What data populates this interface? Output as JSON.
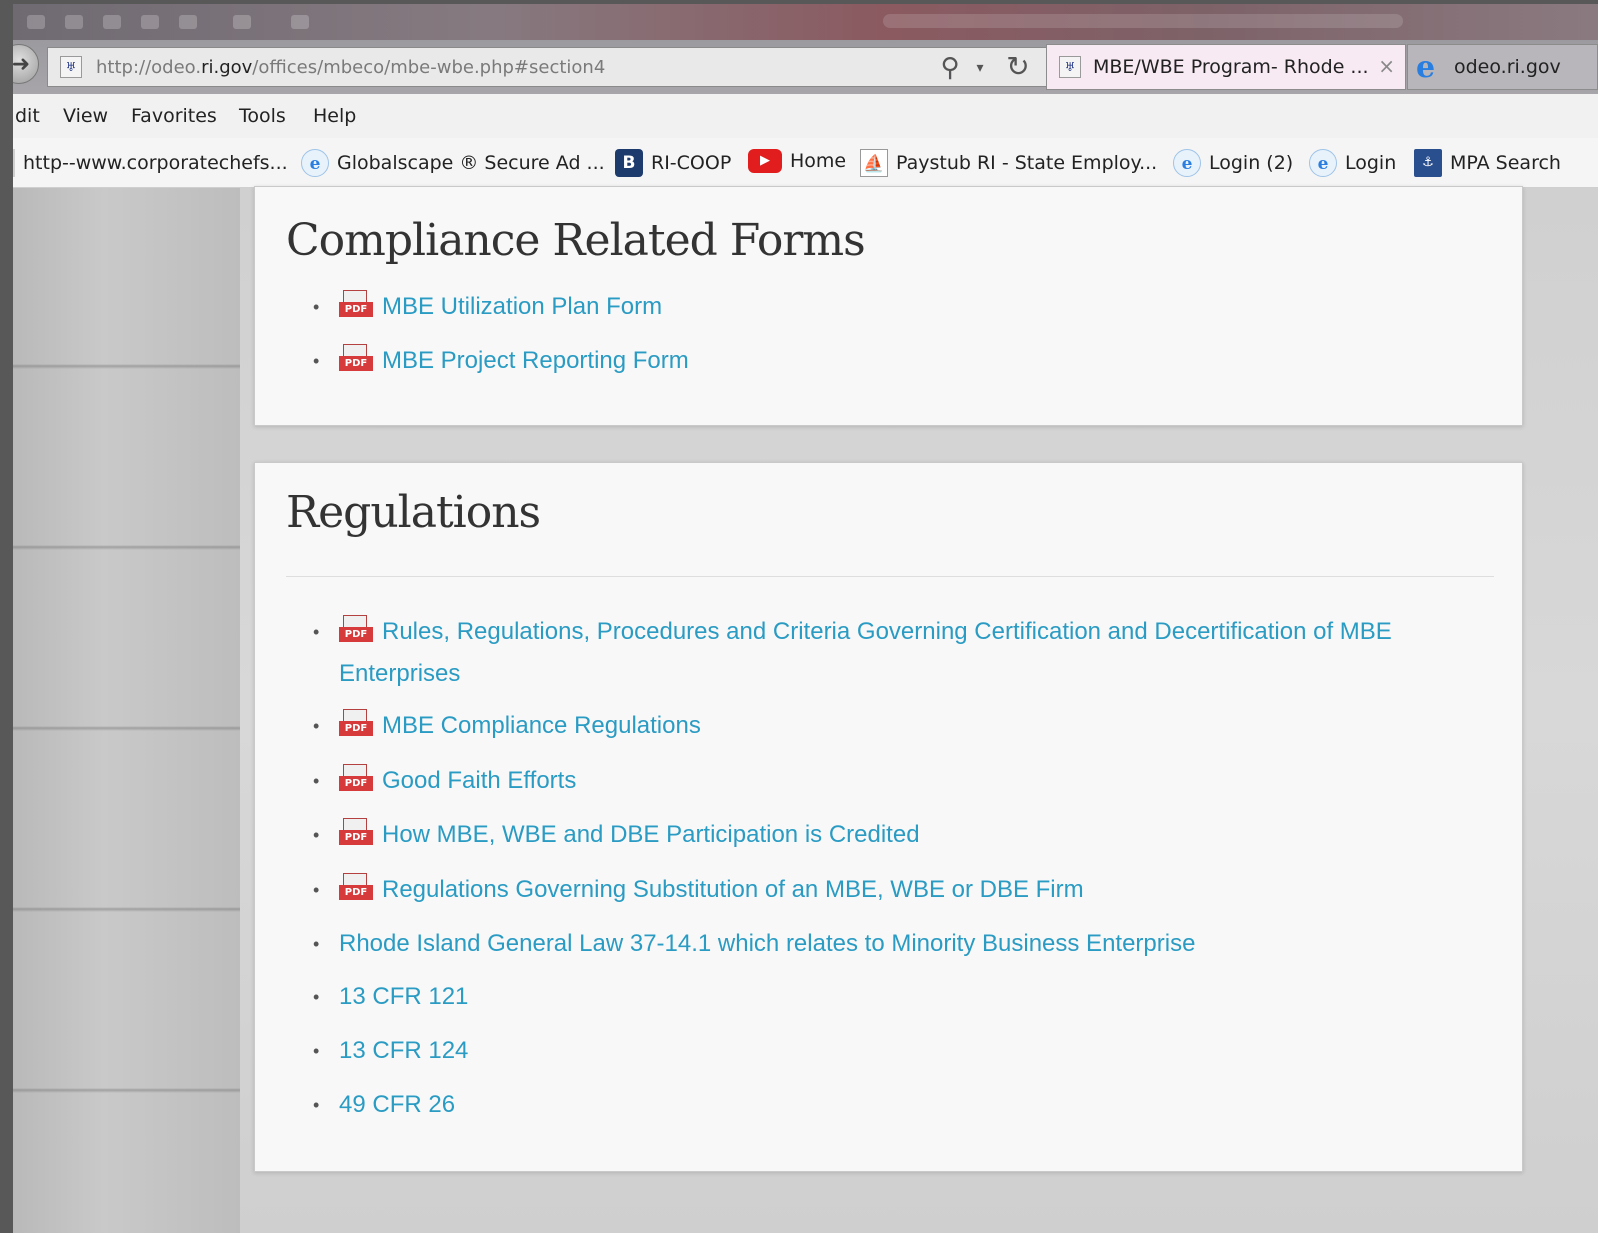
{
  "browser": {
    "address_prefix": "http://odeo.",
    "address_domain": "ri.gov",
    "address_suffix": "/offices/mbeco/mbe-wbe.php#section4",
    "tabs": [
      {
        "label": "MBE/WBE Program- Rhode ...",
        "active": true
      },
      {
        "label": "odeo.ri.gov",
        "active": false
      }
    ],
    "close_glyph": "×"
  },
  "menu": [
    "dit",
    "View",
    "Favorites",
    "Tools",
    "Help"
  ],
  "favorites": [
    {
      "label": "http--www.corporatechefs...",
      "icon": "page-icon"
    },
    {
      "label": "Globalscape ® Secure Ad ...",
      "icon": "ie-icon"
    },
    {
      "label": "RI-COOP",
      "icon": "coop-icon"
    },
    {
      "label": "Home",
      "icon": "youtube-icon"
    },
    {
      "label": "Paystub RI - State Employ...",
      "icon": "paystub-icon"
    },
    {
      "label": "Login (2)",
      "icon": "ie-icon"
    },
    {
      "label": "Login",
      "icon": "ie-icon"
    },
    {
      "label": "MPA Search",
      "icon": "mpa-icon"
    }
  ],
  "sections": {
    "forms": {
      "title": "Compliance Related Forms",
      "links": [
        {
          "text": "MBE Utilization Plan Form",
          "pdf": true
        },
        {
          "text": "MBE Project Reporting Form",
          "pdf": true
        }
      ]
    },
    "regulations": {
      "title": "Regulations",
      "links": [
        {
          "text": "Rules, Regulations, Procedures and Criteria Governing Certification and Decertification of MBE Enterprises",
          "pdf": true
        },
        {
          "text": "MBE Compliance Regulations",
          "pdf": true
        },
        {
          "text": "Good Faith Efforts",
          "pdf": true
        },
        {
          "text": "How MBE, WBE and DBE Participation is Credited",
          "pdf": true
        },
        {
          "text": "Regulations Governing Substitution of an MBE, WBE or DBE Firm",
          "pdf": true
        },
        {
          "text": "Rhode Island General Law 37-14.1 which relates to Minority Business Enterprise",
          "pdf": false
        },
        {
          "text": "13 CFR 121",
          "pdf": false
        },
        {
          "text": "13 CFR 124",
          "pdf": false
        },
        {
          "text": "49 CFR 26",
          "pdf": false
        }
      ]
    }
  },
  "colors": {
    "link": "#2a9bc3",
    "heading": "#333333",
    "pdf_badge": "#d73a3a"
  }
}
